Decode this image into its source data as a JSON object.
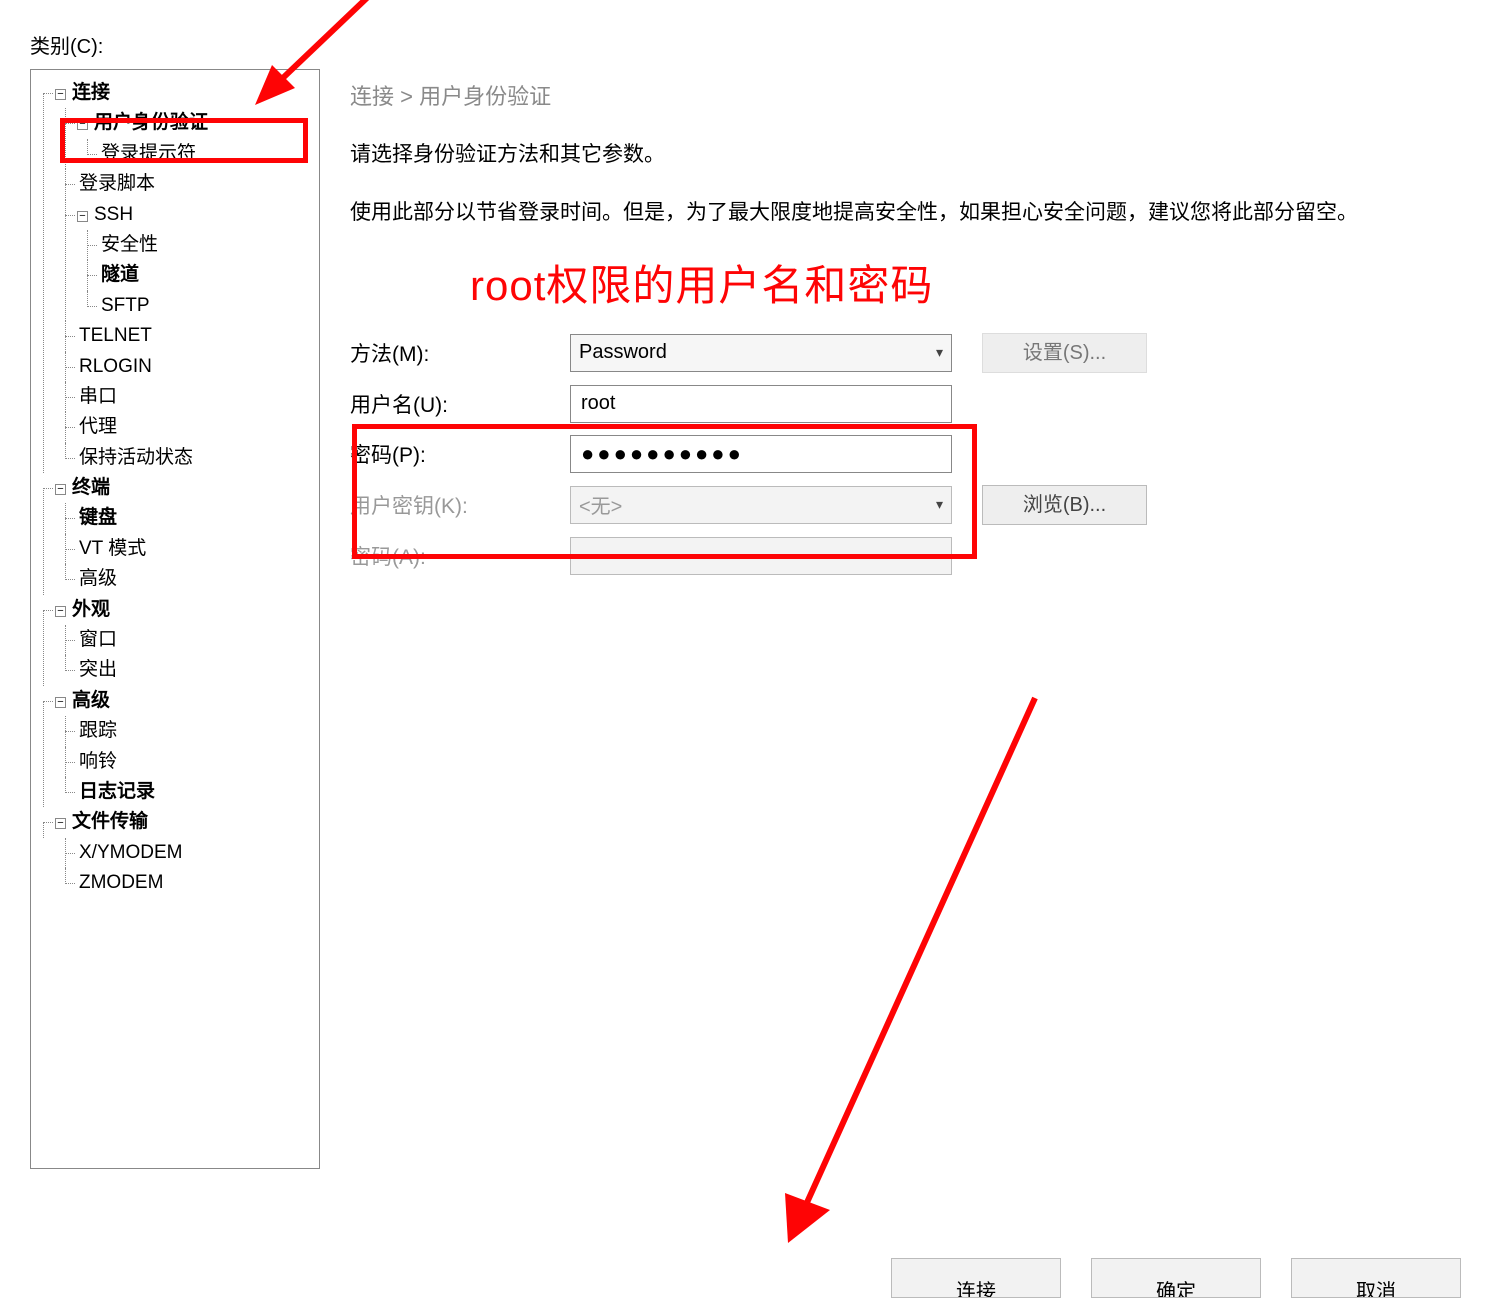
{
  "category_label": "类别(C):",
  "tree": {
    "connection": "连接",
    "user_auth": "用户身份验证",
    "login_prompt": "登录提示符",
    "login_script": "登录脚本",
    "ssh": "SSH",
    "security": "安全性",
    "tunnel": "隧道",
    "sftp": "SFTP",
    "telnet": "TELNET",
    "rlogin": "RLOGIN",
    "serial": "串口",
    "proxy": "代理",
    "keepalive": "保持活动状态",
    "terminal": "终端",
    "keyboard": "键盘",
    "vt_mode": "VT 模式",
    "advanced": "高级",
    "appearance": "外观",
    "window": "窗口",
    "highlight": "突出",
    "advanced2": "高级",
    "trace": "跟踪",
    "bell": "响铃",
    "logging": "日志记录",
    "file_transfer": "文件传输",
    "xymodem": "X/YMODEM",
    "zmodem": "ZMODEM"
  },
  "breadcrumb": "连接 > 用户身份验证",
  "desc1": "请选择身份验证方法和其它参数。",
  "desc2": "使用此部分以节省登录时间。但是，为了最大限度地提高安全性，如果担心安全问题，建议您将此部分留空。",
  "annotation": "root权限的用户名和密码",
  "form": {
    "method_label": "方法(M):",
    "method_value": "Password",
    "username_label": "用户名(U):",
    "username_value": "root",
    "password_label": "密码(P):",
    "password_value": "●●●●●●●●●●",
    "userkey_label": "用户密钥(K):",
    "userkey_value": "<无>",
    "passphrase_label": "密码(A):",
    "settings_btn": "设置(S)...",
    "browse_btn": "浏览(B)..."
  },
  "buttons": {
    "connect": "连接",
    "ok": "确定",
    "cancel": "取消"
  },
  "expander_minus": "−"
}
